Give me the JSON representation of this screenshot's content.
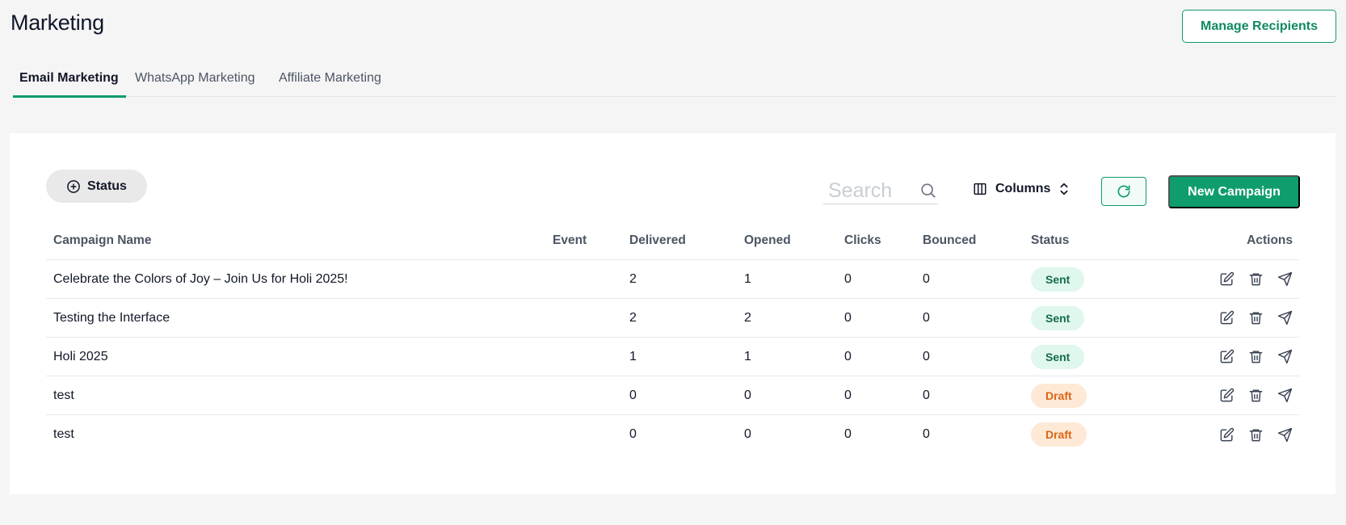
{
  "page": {
    "title": "Marketing"
  },
  "header": {
    "manage_recipients_label": "Manage Recipients"
  },
  "tabs": [
    {
      "label": "Email Marketing",
      "active": true
    },
    {
      "label": "WhatsApp Marketing",
      "active": false
    },
    {
      "label": "Affiliate Marketing",
      "active": false
    }
  ],
  "toolbar": {
    "status_filter_label": "Status",
    "search_placeholder": "Search",
    "columns_label": "Columns",
    "new_campaign_label": "New Campaign"
  },
  "table": {
    "headers": {
      "name": "Campaign Name",
      "event": "Event",
      "delivered": "Delivered",
      "opened": "Opened",
      "clicks": "Clicks",
      "bounced": "Bounced",
      "status": "Status",
      "actions": "Actions"
    },
    "rows": [
      {
        "name": "Celebrate the Colors of Joy – Join Us for Holi 2025!",
        "event": "",
        "delivered": "2",
        "opened": "1",
        "clicks": "0",
        "bounced": "0",
        "status": "Sent"
      },
      {
        "name": "Testing the Interface",
        "event": "",
        "delivered": "2",
        "opened": "2",
        "clicks": "0",
        "bounced": "0",
        "status": "Sent"
      },
      {
        "name": "Holi 2025",
        "event": "",
        "delivered": "1",
        "opened": "1",
        "clicks": "0",
        "bounced": "0",
        "status": "Sent"
      },
      {
        "name": "test",
        "event": "",
        "delivered": "0",
        "opened": "0",
        "clicks": "0",
        "bounced": "0",
        "status": "Draft"
      },
      {
        "name": "test",
        "event": "",
        "delivered": "0",
        "opened": "0",
        "clicks": "0",
        "bounced": "0",
        "status": "Draft"
      }
    ]
  },
  "icons": {
    "status_filter": "plus-circle-icon",
    "search": "search-icon",
    "columns": "columns-icon",
    "columns_toggle": "chevron-up-down-icon",
    "refresh": "refresh-icon",
    "row_actions": [
      "edit-icon",
      "trash-icon",
      "send-icon"
    ]
  },
  "colors": {
    "accent": "#0f9d6e",
    "sent_bg": "#dff7ec",
    "sent_text": "#166c4b",
    "draft_bg": "#fde9d6",
    "draft_text": "#dd6515"
  }
}
